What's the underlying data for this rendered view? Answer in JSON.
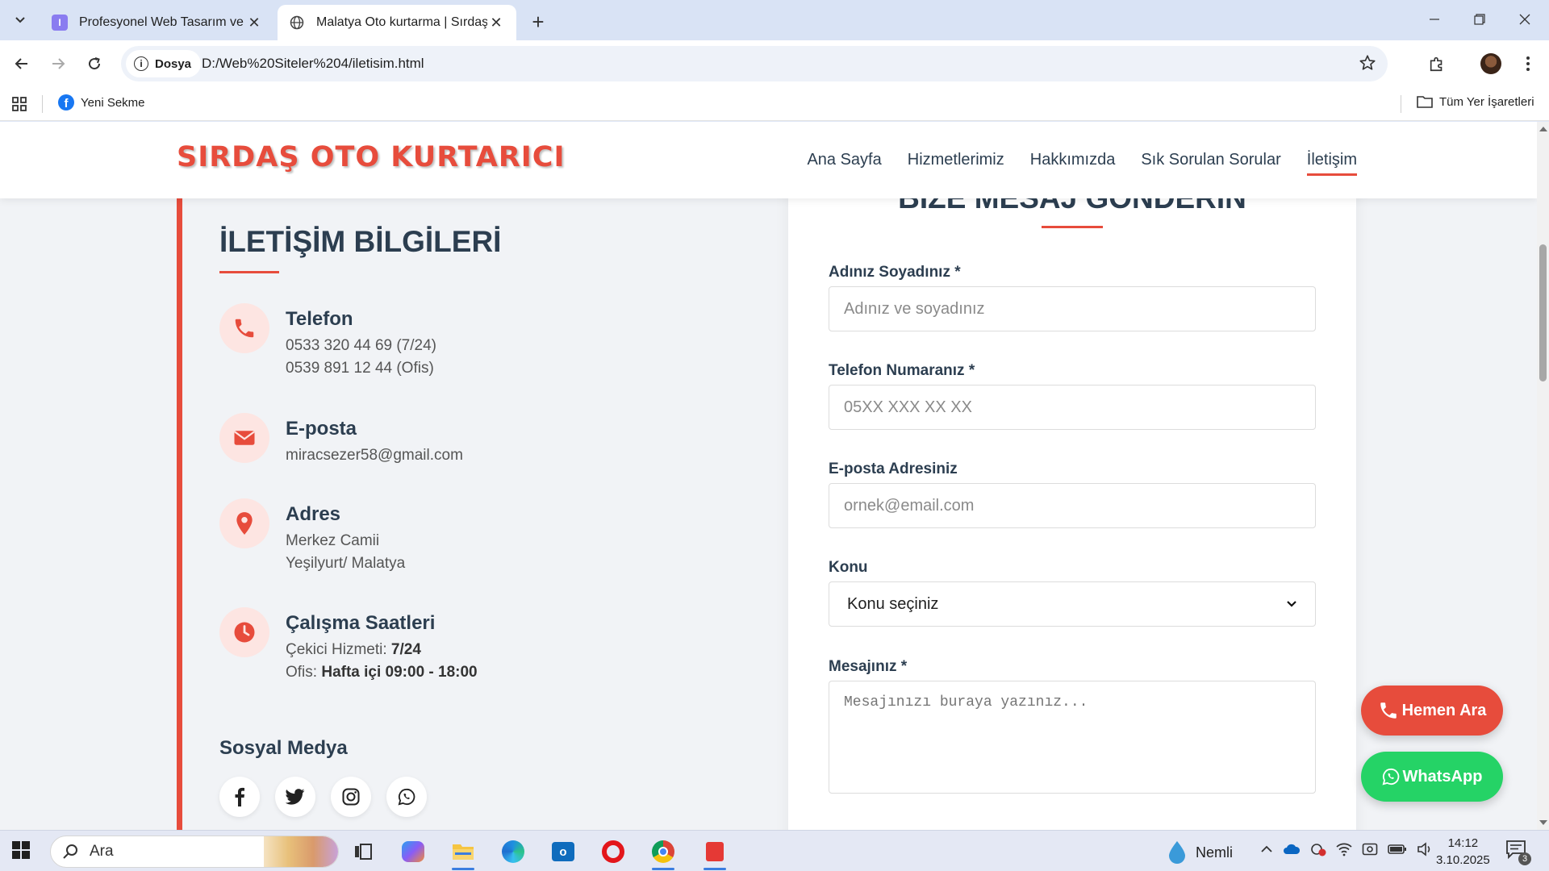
{
  "browser": {
    "tabs": [
      {
        "title": "Profesyonel Web Tasarım ve Dij",
        "active": false
      },
      {
        "title": "Malatya Oto kurtarma | Sırdaş O",
        "active": true
      }
    ],
    "new_tab_label": "+",
    "omnibox": {
      "chip_label": "Dosya",
      "url": "D:/Web%20Siteler%204/iletisim.html"
    },
    "bookmarks": {
      "item": "Yeni Sekme",
      "all": "Tüm Yer İşaretleri"
    }
  },
  "site": {
    "logo": "SIRDAŞ OTO KURTARICI",
    "nav": [
      "Ana Sayfa",
      "Hizmetlerimiz",
      "Hakkımızda",
      "Sık Sorulan Sorular",
      "İletişim"
    ],
    "nav_active_index": 4,
    "accent_color": "#e74c3c"
  },
  "contact_info": {
    "heading": "İLETİŞİM BİLGİLERİ",
    "items": [
      {
        "icon": "phone-icon",
        "label": "Telefon",
        "lines": [
          "0533 320 44 69 (7/24)",
          "0539 891 12 44 (Ofis)"
        ]
      },
      {
        "icon": "envelope-icon",
        "label": "E-posta",
        "lines": [
          "miracsezer58@gmail.com"
        ]
      },
      {
        "icon": "map-pin-icon",
        "label": "Adres",
        "lines": [
          "Merkez Camii",
          "Yeşilyurt/ Malatya"
        ]
      },
      {
        "icon": "clock-icon",
        "label": "Çalışma Saatleri",
        "hours": [
          {
            "prefix": "Çekici Hizmeti: ",
            "value": "7/24"
          },
          {
            "prefix": "Ofis: ",
            "value": "Hafta içi 09:00 - 18:00"
          }
        ]
      }
    ],
    "social_title": "Sosyal Medya",
    "social": [
      "facebook-icon",
      "twitter-icon",
      "instagram-icon",
      "whatsapp-icon"
    ]
  },
  "form": {
    "heading": "BİZE MESAJ GÖNDERİN",
    "name_label": "Adınız Soyadınız *",
    "name_placeholder": "Adınız ve soyadınız",
    "phone_label": "Telefon Numaranız *",
    "phone_placeholder": "05XX XXX XX XX",
    "email_label": "E-posta Adresiniz",
    "email_placeholder": "ornek@email.com",
    "subject_label": "Konu",
    "subject_selected": "Konu seçiniz",
    "message_label": "Mesajınız *",
    "message_placeholder": "Mesajınızı buraya yazınız..."
  },
  "floating": {
    "call": "Hemen Ara",
    "whatsapp": "WhatsApp"
  },
  "taskbar": {
    "search": "Ara",
    "weather": "Nemli",
    "time": "14:12",
    "date": "3.10.2025",
    "notifications": "3"
  }
}
